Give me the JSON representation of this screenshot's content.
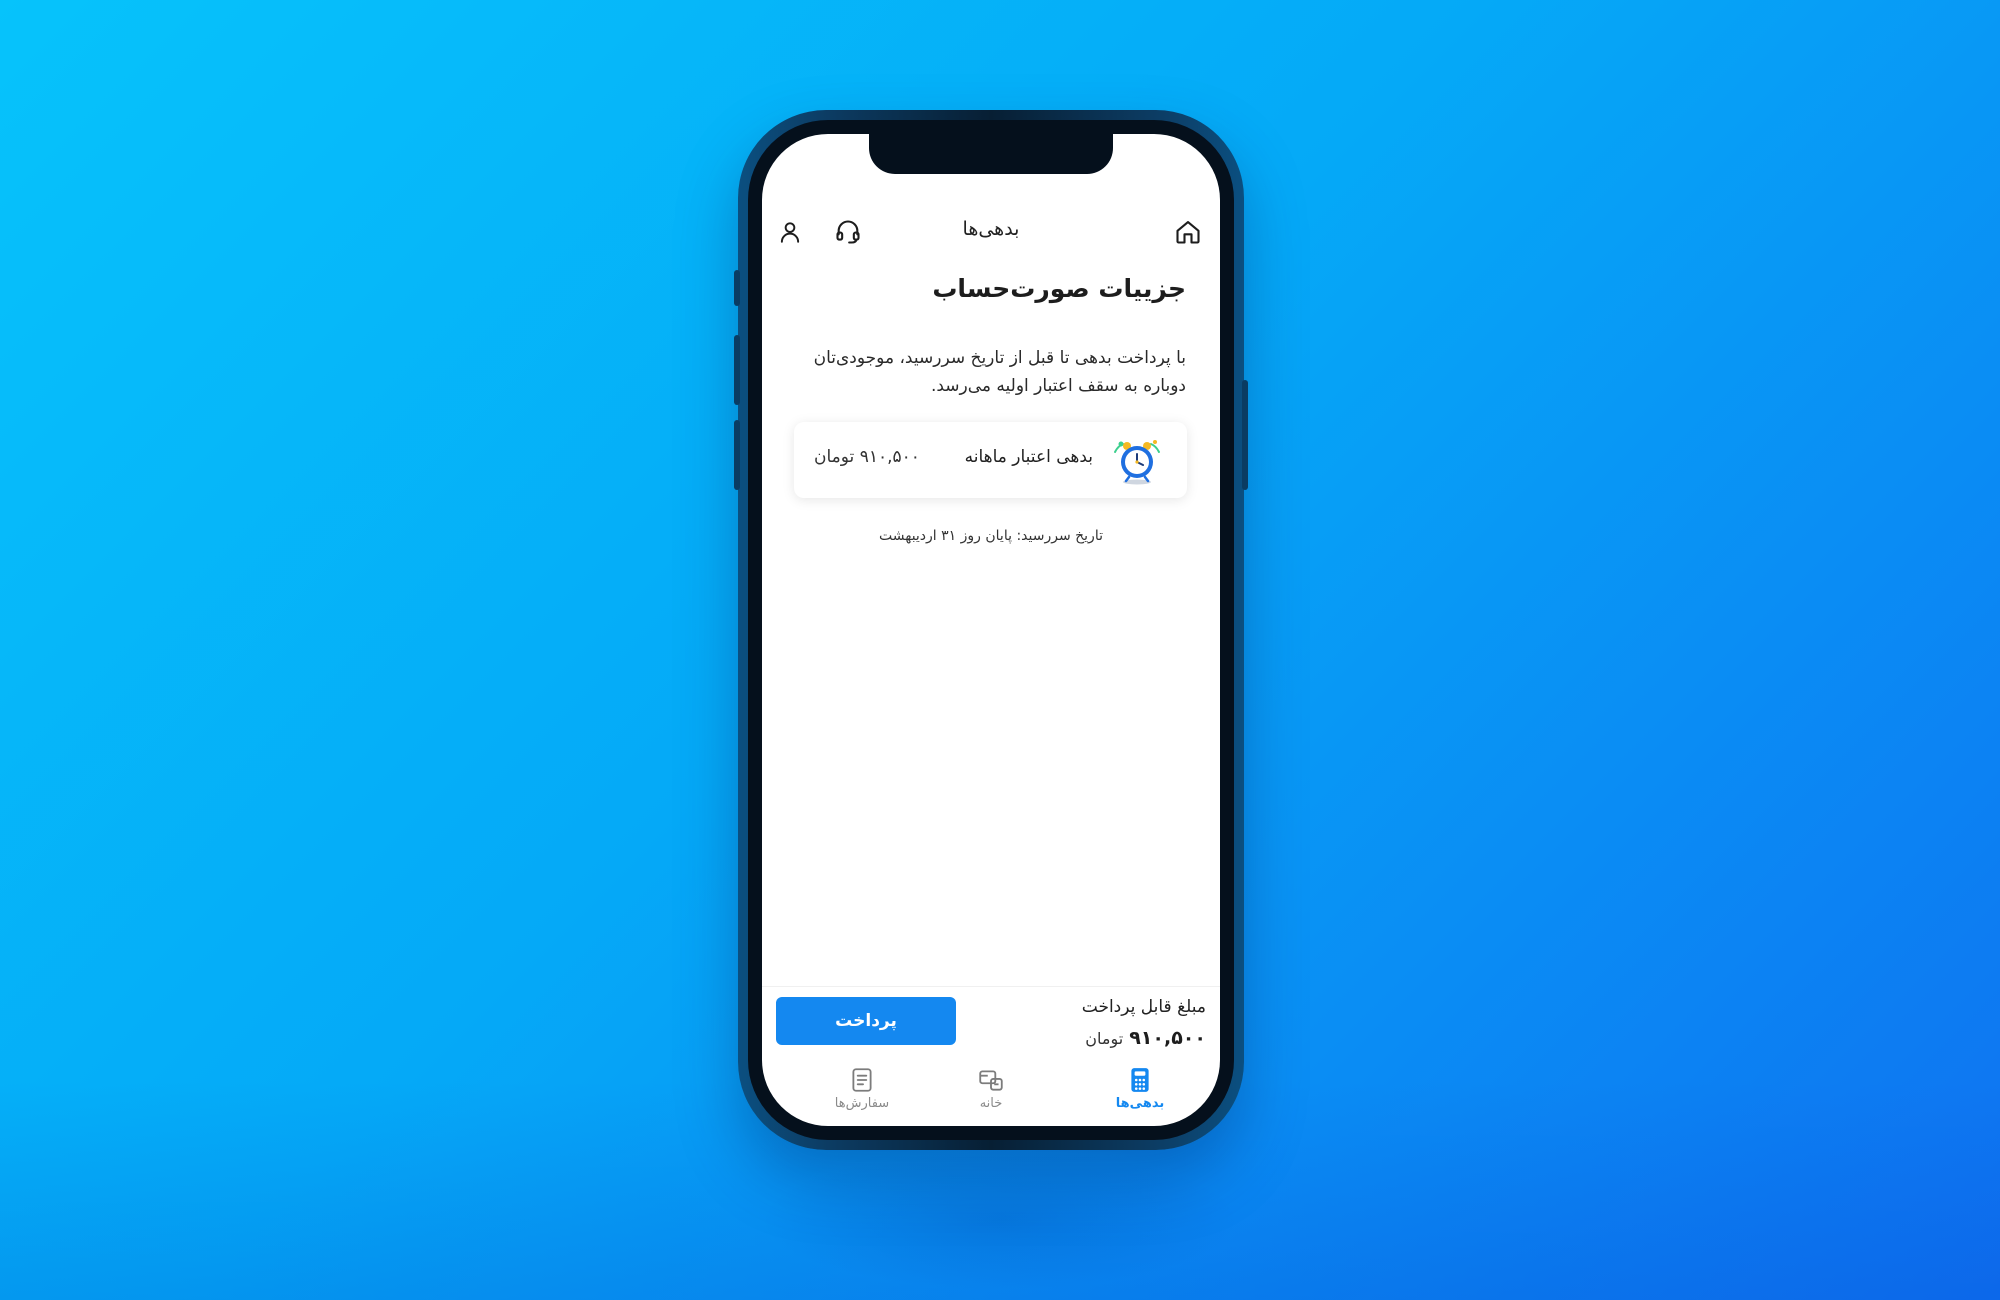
{
  "header": {
    "title": "بدهی‌ها",
    "home_icon": "home-icon",
    "support_icon": "headset-icon",
    "profile_icon": "user-icon"
  },
  "main": {
    "page_title": "جزییات صورت‌حساب",
    "description": "با پرداخت بدهی تا قبل از تاریخ سررسید، موجودی‌تان دوباره به سقف اعتبار اولیه می‌رسد.",
    "card": {
      "label": "بدهی اعتبار ماهانه",
      "amount": "۹۱۰,۵۰۰ تومان",
      "icon": "alarm-clock-icon"
    },
    "due_date": "تاریخ سررسید: پایان روز ۳۱ اردیبهشت"
  },
  "payment": {
    "label": "مبلغ قابل پرداخت",
    "amount": "۹۱۰,۵۰۰",
    "currency": "تومان",
    "button_label": "پرداخت"
  },
  "bottom_nav": {
    "items": [
      {
        "label": "بدهی‌ها",
        "icon": "calculator-icon",
        "active": true
      },
      {
        "label": "خانه",
        "icon": "wallet-icon",
        "active": false
      },
      {
        "label": "سفارش‌ها",
        "icon": "receipt-icon",
        "active": false
      }
    ]
  },
  "colors": {
    "accent": "#1488f0",
    "background_start": "#06c3fb",
    "background_end": "#0f71f1"
  }
}
